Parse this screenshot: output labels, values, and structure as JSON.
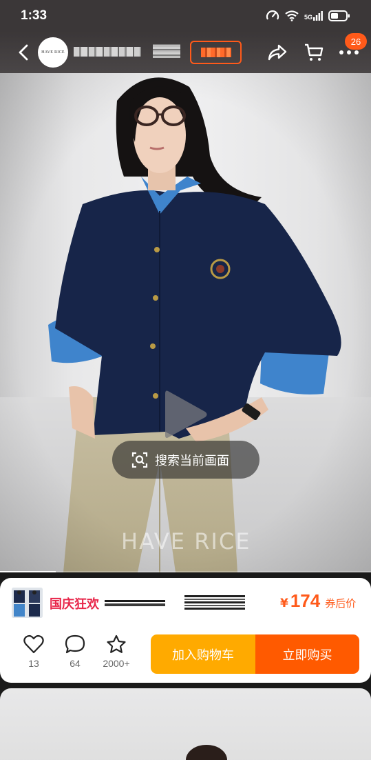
{
  "status_bar": {
    "time": "1:33",
    "network": "5G",
    "icons": [
      "data-saver-icon",
      "wifi-icon",
      "signal-icon",
      "battery-icon"
    ]
  },
  "nav": {
    "shop_logo_text": "HAVE RICE",
    "notification_count": "26",
    "icons": [
      "back-icon",
      "share-icon",
      "cart-icon",
      "more-icon"
    ]
  },
  "media": {
    "search_frame_label": "搜索当前画面",
    "watermark": "HAVE RICE",
    "progress": 0.15,
    "icons": [
      "play-icon",
      "scan-search-icon"
    ]
  },
  "product": {
    "promo_title": "国庆狂欢",
    "price_currency": "¥",
    "price": "174",
    "price_note": "券后价"
  },
  "stats": {
    "likes": "13",
    "comments": "64",
    "favorites": "2000+"
  },
  "actions": {
    "add_to_cart": "加入购物车",
    "buy_now": "立即购买"
  },
  "colors": {
    "accent_orange": "#ff5a00",
    "cart_yellow": "#ffaa00",
    "promo_red": "#e8264a"
  }
}
